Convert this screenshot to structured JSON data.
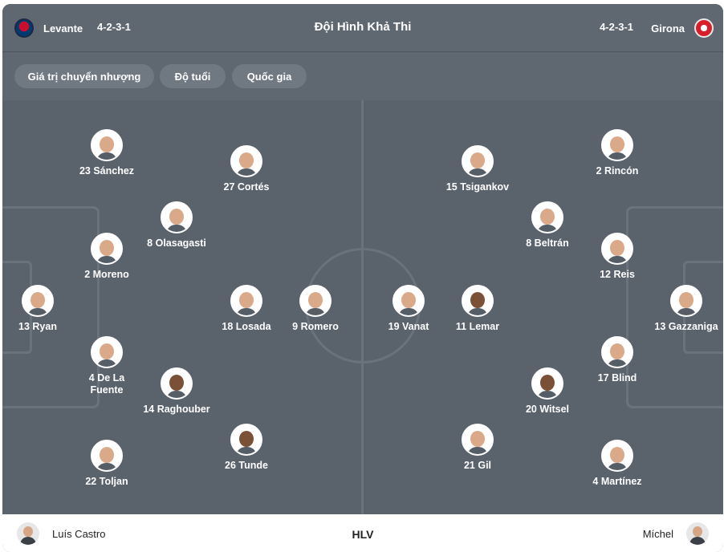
{
  "header": {
    "home_team": "Levante",
    "home_formation": "4-2-3-1",
    "title": "Đội Hình Khả Thi",
    "away_formation": "4-2-3-1",
    "away_team": "Girona"
  },
  "filters": [
    "Giá trị chuyển nhượng",
    "Độ tuổi",
    "Quốc gia"
  ],
  "home_players": [
    "23 Sánchez",
    "27 Cortés",
    "8 Olasagasti",
    "2 Moreno",
    "13 Ryan",
    "18 Losada",
    "9 Romero",
    "4 De La Fuente",
    "14 Raghouber",
    "26 Tunde",
    "22 Toljan"
  ],
  "away_players": [
    "2 Rincón",
    "15 Tsigankov",
    "8 Beltrán",
    "12 Reis",
    "19 Vanat",
    "11 Lemar",
    "13 Gazzaniga",
    "17 Blind",
    "20 Witsel",
    "21 Gil",
    "4 Martínez"
  ],
  "footer": {
    "home_coach": "Luís Castro",
    "label": "HLV",
    "away_coach": "Míchel"
  },
  "colors": {
    "pitch": "#5a626c",
    "header": "#5f6771",
    "chip": "#707882"
  },
  "icons": [
    "levante-crest-icon",
    "girona-crest-icon",
    "player-photo",
    "coach-photo"
  ]
}
